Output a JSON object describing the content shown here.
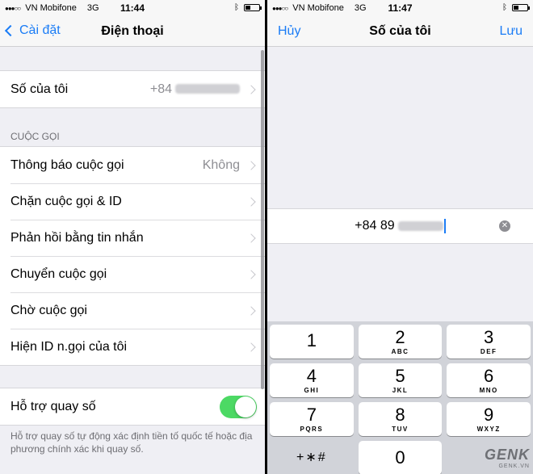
{
  "left": {
    "status": {
      "carrier": "VN Mobifone",
      "network": "3G",
      "time": "11:44"
    },
    "nav": {
      "back_label": "Cài đặt",
      "title": "Điện thoại"
    },
    "my_number": {
      "label": "Số của tôi",
      "value_prefix": "+84"
    },
    "calls_section": {
      "header": "CUỘC GỌI",
      "items": [
        {
          "label": "Thông báo cuộc gọi",
          "value": "Không"
        },
        {
          "label": "Chặn cuộc gọi & ID",
          "value": ""
        },
        {
          "label": "Phản hồi bằng tin nhắn",
          "value": ""
        },
        {
          "label": "Chuyển cuộc gọi",
          "value": ""
        },
        {
          "label": "Chờ cuộc gọi",
          "value": ""
        },
        {
          "label": "Hiện ID n.gọi của tôi",
          "value": ""
        }
      ]
    },
    "dial_assist": {
      "label": "Hỗ trợ quay số",
      "enabled": true,
      "note": "Hỗ trợ quay số tự động xác định tiền tố quốc tế hoặc địa phương chính xác khi quay số."
    }
  },
  "right": {
    "status": {
      "carrier": "VN Mobifone",
      "network": "3G",
      "time": "11:47"
    },
    "nav": {
      "cancel_label": "Hủy",
      "title": "Số của tôi",
      "save_label": "Lưu"
    },
    "phone_field": {
      "value_prefix": "+84 89"
    },
    "keypad": {
      "rows": [
        [
          {
            "num": "1",
            "letters": ""
          },
          {
            "num": "2",
            "letters": "ABC"
          },
          {
            "num": "3",
            "letters": "DEF"
          }
        ],
        [
          {
            "num": "4",
            "letters": "GHI"
          },
          {
            "num": "5",
            "letters": "JKL"
          },
          {
            "num": "6",
            "letters": "MNO"
          }
        ],
        [
          {
            "num": "7",
            "letters": "PQRS"
          },
          {
            "num": "8",
            "letters": "TUV"
          },
          {
            "num": "9",
            "letters": "WXYZ"
          }
        ],
        [
          {
            "num": "+∗#",
            "letters": ""
          },
          {
            "num": "0",
            "letters": ""
          },
          {
            "num": "",
            "letters": ""
          }
        ]
      ]
    },
    "watermark": {
      "brand": "GENK",
      "site": "GENK.VN"
    }
  },
  "colors": {
    "accent": "#1a7cf6",
    "toggle_on": "#4cd964",
    "background": "#efeff4"
  }
}
